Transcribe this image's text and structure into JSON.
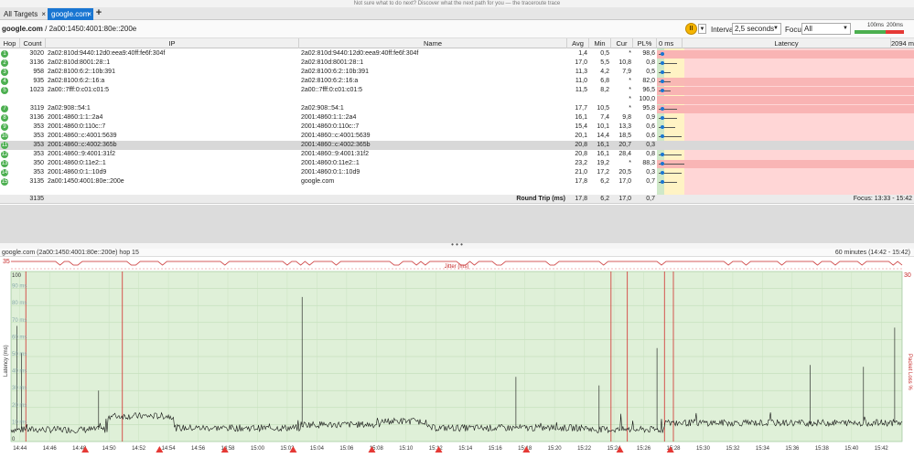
{
  "top_strip": "Not sure what to do next? Discover what the next path for you — the traceroute trace",
  "tabs": {
    "all_targets": "All Targets",
    "active": "google.com",
    "close_glyph": "×",
    "add_glyph": "+"
  },
  "toolbar": {
    "target_host": "google.com",
    "target_addr": "/ 2a00:1450:4001:80e::200e",
    "pause_glyph": "II",
    "menu_glyph": "▼",
    "interval_label": "Interval",
    "interval_value": "2,5 seconds",
    "focus_label": "Focus",
    "focus_value": "All",
    "legend_100": "100ms",
    "legend_200": "200ms"
  },
  "colors": {
    "good": "#4caf50",
    "warn": "#f6b500",
    "bad": "#e53935",
    "selected_row": "#d8d8d8",
    "tab_active": "#1976d2"
  },
  "grid": {
    "columns": [
      "Hop",
      "Count",
      "IP",
      "Name",
      "Avg",
      "Min",
      "Cur",
      "PL%",
      "0 ms",
      "Latency",
      "2094 ms"
    ],
    "rows": [
      {
        "hop": "1",
        "count": "3020",
        "ip": "2a02:810d:9440:12d0:eea9:40ff:fe6f:304f",
        "name": "2a02:810d:9440:12d0:eea9:40ff:fe6f:304f",
        "avg": "1,4",
        "min": "0,5",
        "cur": "*",
        "pl": "98,6",
        "loss": 0.986,
        "lat": 0.001
      },
      {
        "hop": "2",
        "count": "3136",
        "ip": "2a02:810d:8001:28::1",
        "name": "2a02:810d:8001:28::1",
        "avg": "17,0",
        "min": "5,5",
        "cur": "10,8",
        "pl": "0,8",
        "loss": 0.008,
        "lat": 0.008
      },
      {
        "hop": "3",
        "count": "958",
        "ip": "2a02:8100:6:2::10b:391",
        "name": "2a02:8100:6:2::10b:391",
        "avg": "11,3",
        "min": "4,2",
        "cur": "7,9",
        "pl": "0,5",
        "loss": 0.005,
        "lat": 0.005
      },
      {
        "hop": "4",
        "count": "935",
        "ip": "2a02:8100:6:2::16:a",
        "name": "2a02:8100:6:2::16:a",
        "avg": "11,0",
        "min": "6,8",
        "cur": "*",
        "pl": "82,0",
        "loss": 0.82,
        "lat": 0.005
      },
      {
        "hop": "5",
        "count": "1023",
        "ip": "2a00::7fff:0:c01:c01:5",
        "name": "2a00::7fff:0:c01:c01:5",
        "avg": "11,5",
        "min": "8,2",
        "cur": "*",
        "pl": "96,5",
        "loss": 0.965,
        "lat": 0.005
      },
      {
        "hop": "",
        "count": "",
        "ip": "",
        "name": "",
        "avg": "",
        "min": "",
        "cur": "*",
        "pl": "100,0",
        "loss": 1.0,
        "lat": 0
      },
      {
        "hop": "7",
        "count": "3119",
        "ip": "2a02:908::54:1",
        "name": "2a02:908::54:1",
        "avg": "17,7",
        "min": "10,5",
        "cur": "*",
        "pl": "95,8",
        "loss": 0.958,
        "lat": 0.008
      },
      {
        "hop": "8",
        "count": "3136",
        "ip": "2001:4860:1:1::2a4",
        "name": "2001:4860:1:1::2a4",
        "avg": "16,1",
        "min": "7,4",
        "cur": "9,8",
        "pl": "0,9",
        "loss": 0.009,
        "lat": 0.008
      },
      {
        "hop": "9",
        "count": "353",
        "ip": "2001:4860:0:110c::7",
        "name": "2001:4860:0:110c::7",
        "avg": "15,4",
        "min": "10,1",
        "cur": "13,3",
        "pl": "0,6",
        "loss": 0.006,
        "lat": 0.007
      },
      {
        "hop": "10",
        "count": "353",
        "ip": "2001:4860::c:4001:5639",
        "name": "2001:4860::c:4001:5639",
        "avg": "20,1",
        "min": "14,4",
        "cur": "18,5",
        "pl": "0,6",
        "loss": 0.006,
        "lat": 0.01
      },
      {
        "hop": "11",
        "count": "353",
        "ip": "2001:4860::c:4002:365b",
        "name": "2001:4860::c:4002:365b",
        "avg": "20,8",
        "min": "16,1",
        "cur": "20,7",
        "pl": "0,3",
        "loss": 0.003,
        "lat": 0.01,
        "selected": true
      },
      {
        "hop": "12",
        "count": "353",
        "ip": "2001:4860::9:4001:31f2",
        "name": "2001:4860::9:4001:31f2",
        "avg": "20,8",
        "min": "16,1",
        "cur": "28,4",
        "pl": "0,8",
        "loss": 0.008,
        "lat": 0.01
      },
      {
        "hop": "13",
        "count": "350",
        "ip": "2001:4860:0:11e2::1",
        "name": "2001:4860:0:11e2::1",
        "avg": "23,2",
        "min": "19,2",
        "cur": "*",
        "pl": "88,3",
        "loss": 0.883,
        "lat": 0.011
      },
      {
        "hop": "14",
        "count": "353",
        "ip": "2001:4860:0:1::10d9",
        "name": "2001:4860:0:1::10d9",
        "avg": "21,0",
        "min": "17,2",
        "cur": "20,5",
        "pl": "0,3",
        "loss": 0.003,
        "lat": 0.01
      },
      {
        "hop": "15",
        "count": "3135",
        "ip": "2a00:1450:4001:80e::200e",
        "name": "google.com",
        "avg": "17,8",
        "min": "6,2",
        "cur": "17,0",
        "pl": "0,7",
        "loss": 0.007,
        "lat": 0.008
      }
    ],
    "footer": {
      "count": "3135",
      "label": "Round Trip (ms)",
      "avg": "17,8",
      "min": "6,2",
      "cur": "17,0",
      "pl": "0,7",
      "focus": "Focus: 13:33 - 15:42"
    }
  },
  "graph": {
    "title_left": "google.com (2a00:1450:4001:80e::200e) hop 15",
    "title_right": "60 minutes (14:42 - 15:42)",
    "splitter_glyph": "• • •",
    "jitter_label": "Jitter (ms)",
    "left_axis_label": "Latency (ms)",
    "right_axis_label": "Packet Loss %"
  },
  "chart_data": {
    "type": "line",
    "ylabel": "Latency (ms)",
    "y2label": "Packet Loss %",
    "ylim": [
      0,
      100
    ],
    "y2lim": [
      0,
      30
    ],
    "jitter_ylim": [
      0,
      35
    ],
    "ytick_labels": [
      "100",
      "90 ms",
      "80 ms",
      "70 ms",
      "60 ms",
      "50 ms",
      "40 ms",
      "30 ms",
      "20 ms",
      "10 ms",
      "0"
    ],
    "y2tick_labels": [
      "30"
    ],
    "jitter_tick": "35",
    "xtick_labels": [
      "14:44",
      "14:46",
      "14:48",
      "14:50",
      "14:52",
      "14:54",
      "14:56",
      "14:58",
      "15:00",
      "15:02",
      "15:04",
      "15:06",
      "15:08",
      "15:10",
      "15:12",
      "15:14",
      "15:16",
      "15:18",
      "15:20",
      "15:22",
      "15:24",
      "15:26",
      "15:28",
      "15:30",
      "15:32",
      "15:34",
      "15:36",
      "15:38",
      "15:40",
      "15:42"
    ],
    "x_start_min": 0,
    "x_end_min": 60,
    "baseline_segments": [
      {
        "t0": 0,
        "t1": 6.5,
        "ms": 7
      },
      {
        "t0": 6.5,
        "t1": 11,
        "ms": 15
      },
      {
        "t0": 11,
        "t1": 19.5,
        "ms": 8
      },
      {
        "t0": 19.5,
        "t1": 25,
        "ms": 10
      },
      {
        "t0": 25,
        "t1": 28,
        "ms": 12
      },
      {
        "t0": 28,
        "t1": 39,
        "ms": 8
      },
      {
        "t0": 39,
        "t1": 44,
        "ms": 7
      },
      {
        "t0": 44,
        "t1": 60,
        "ms": 11
      }
    ],
    "latency_spikes": [
      {
        "t": 0.4,
        "ms": 68
      },
      {
        "t": 0.7,
        "ms": 52
      },
      {
        "t": 5.9,
        "ms": 30
      },
      {
        "t": 19.6,
        "ms": 85
      },
      {
        "t": 34.0,
        "ms": 38
      },
      {
        "t": 39.6,
        "ms": 33
      },
      {
        "t": 43.5,
        "ms": 55
      },
      {
        "t": 53.8,
        "ms": 45
      },
      {
        "t": 57.4,
        "ms": 44
      },
      {
        "t": 59.5,
        "ms": 67
      }
    ],
    "loss_events_min": [
      1.0,
      7.5,
      40.4,
      41.5,
      44.0,
      44.6
    ],
    "loss_markers_min": [
      5.0,
      10.0,
      14.4,
      19.0,
      24.3,
      28.8,
      34.7,
      41.0,
      44.4
    ]
  }
}
